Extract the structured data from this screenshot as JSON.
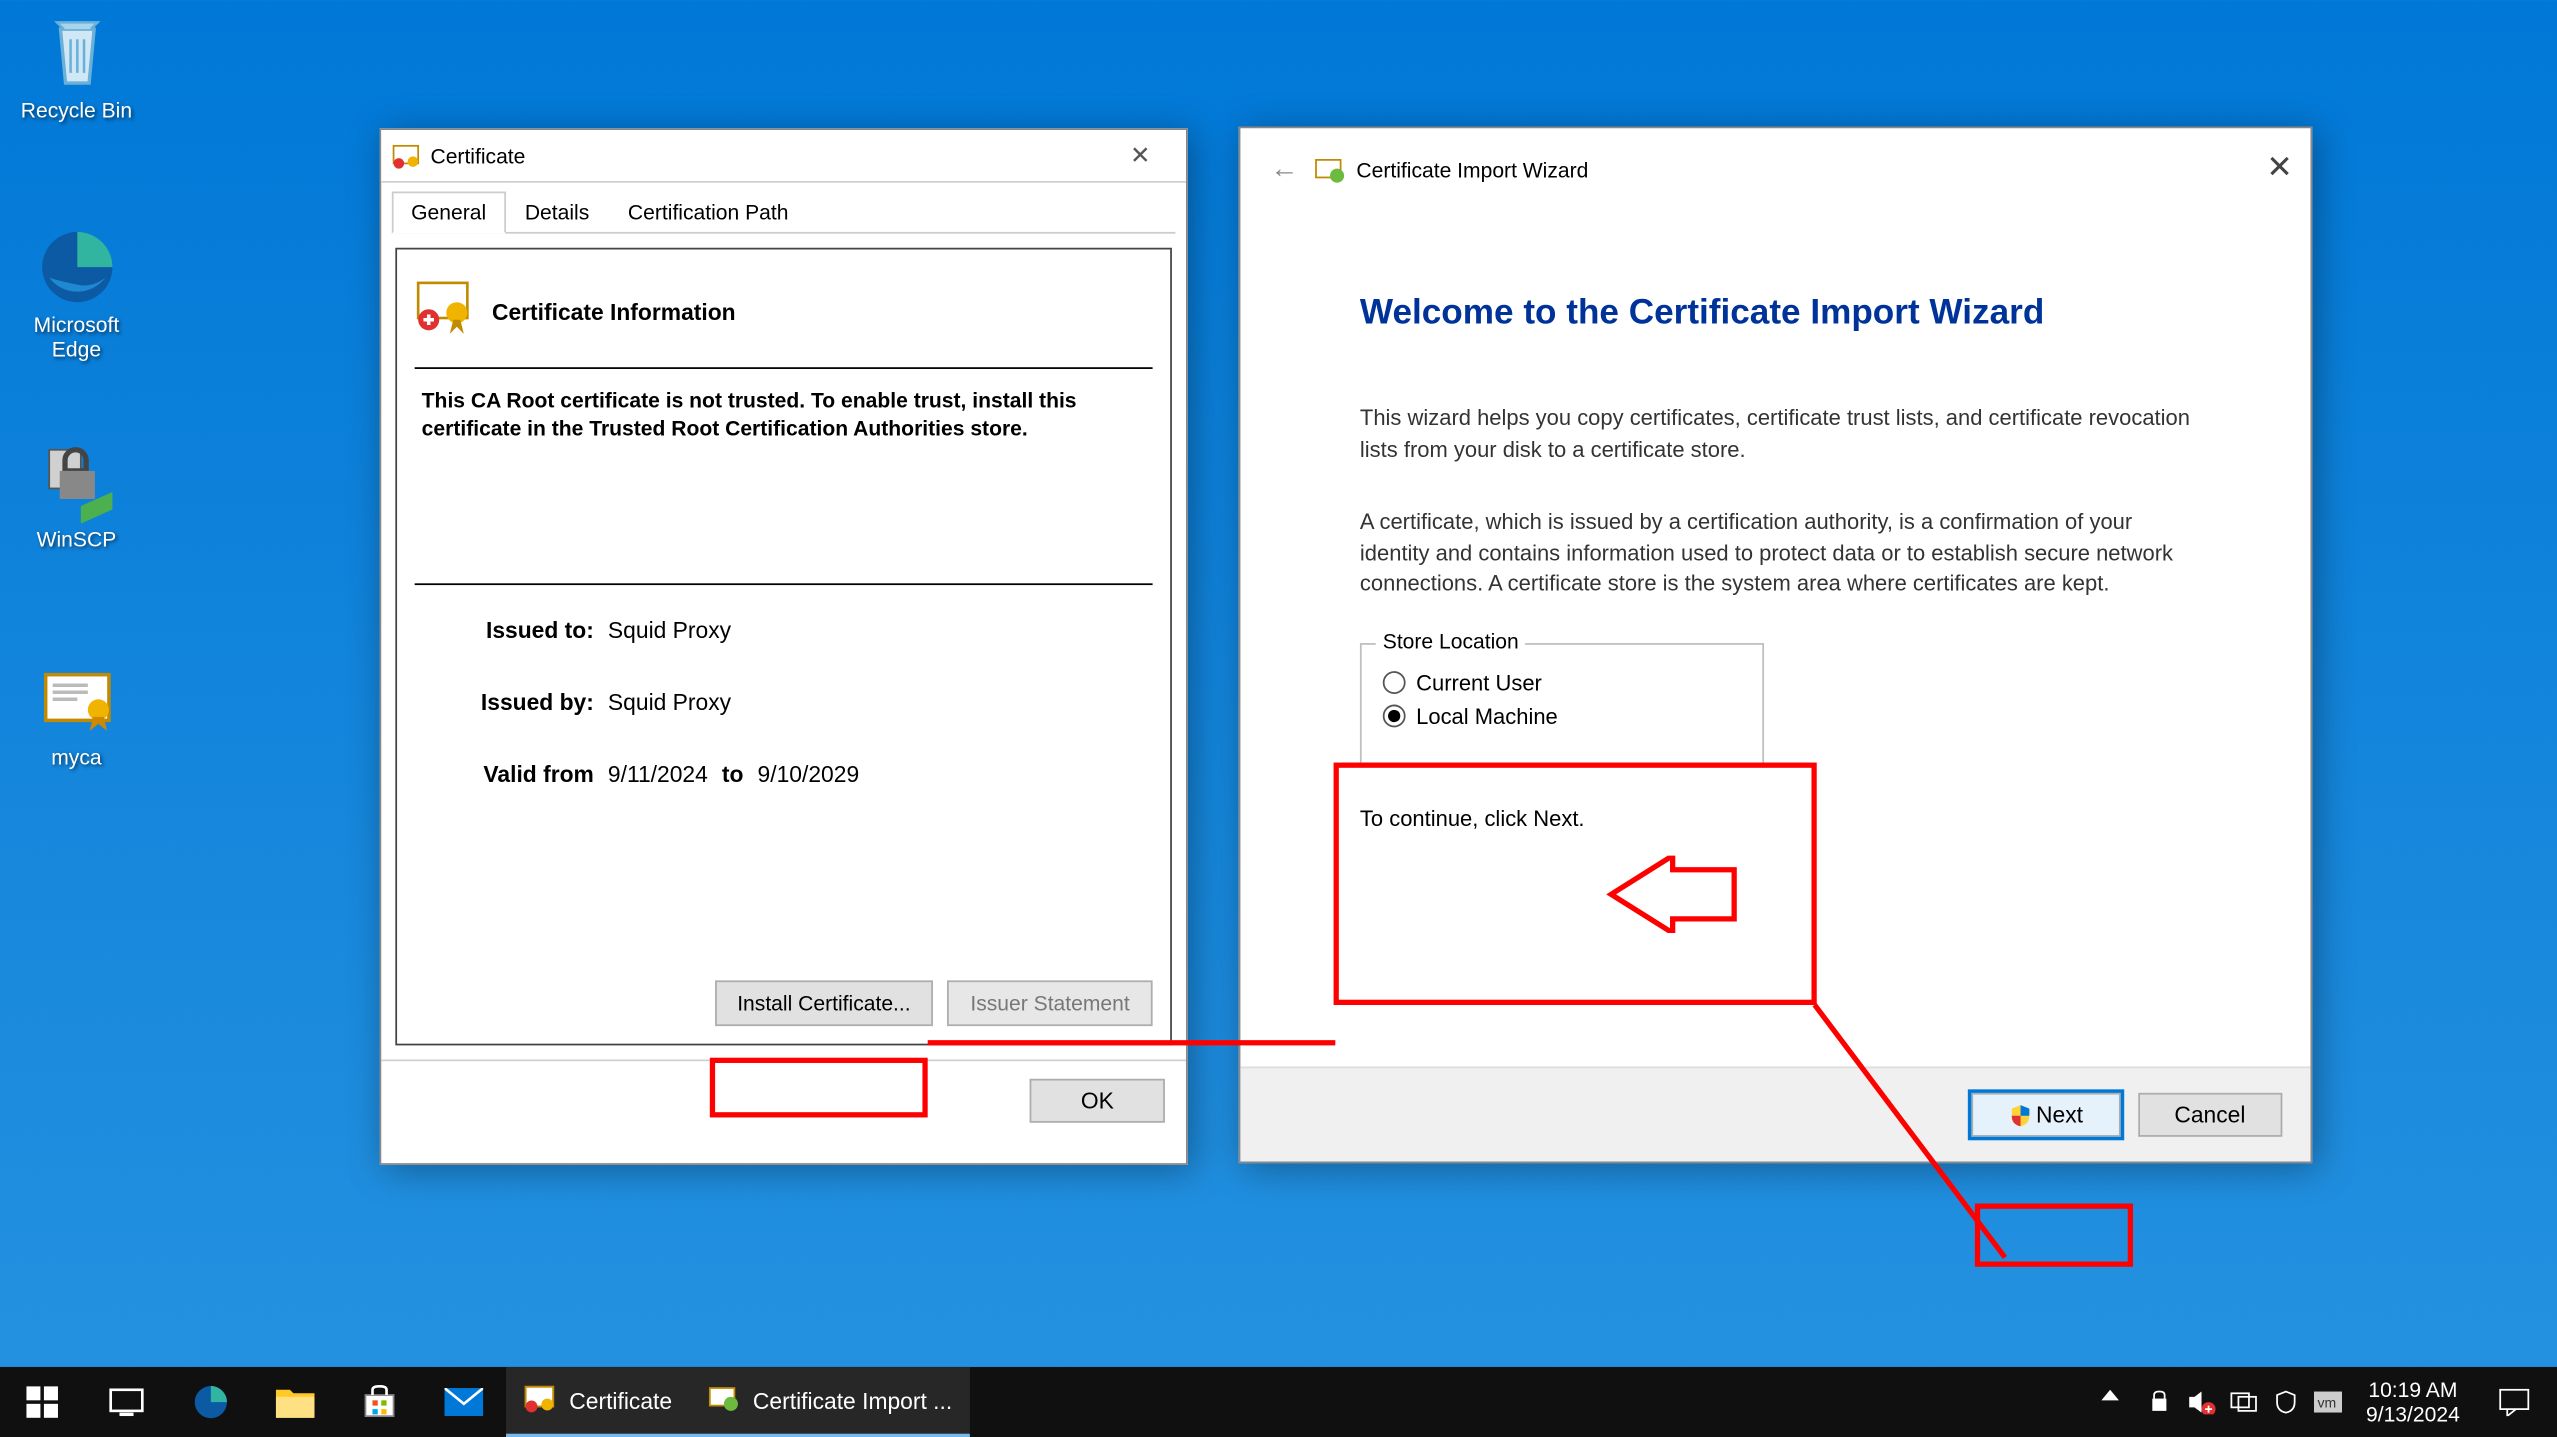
{
  "desktop": {
    "recycle": "Recycle Bin",
    "edge": "Microsoft Edge",
    "winscp": "WinSCP",
    "myca": "myca"
  },
  "cert": {
    "title": "Certificate",
    "tabs": {
      "general": "General",
      "details": "Details",
      "certpath": "Certification Path"
    },
    "header": "Certificate Information",
    "warn": "This CA Root certificate is not trusted. To enable trust, install this certificate in the Trusted Root Certification Authorities store.",
    "issued_to_k": "Issued to:",
    "issued_to_v": "Squid Proxy",
    "issued_by_k": "Issued by:",
    "issued_by_v": "Squid Proxy",
    "valid_k": "Valid from",
    "valid_from": "9/11/2024",
    "valid_to_lbl": "to",
    "valid_to": "9/10/2029",
    "install_btn": "Install Certificate...",
    "issuer_btn": "Issuer Statement",
    "ok": "OK"
  },
  "wizard": {
    "title": "Certificate Import Wizard",
    "welcome": "Welcome to the Certificate Import Wizard",
    "p1": "This wizard helps you copy certificates, certificate trust lists, and certificate revocation lists from your disk to a certificate store.",
    "p2": "A certificate, which is issued by a certification authority, is a confirmation of your identity and contains information used to protect data or to establish secure network connections. A certificate store is the system area where certificates are kept.",
    "store_legend": "Store Location",
    "opt_user": "Current User",
    "opt_machine": "Local Machine",
    "continue": "To continue, click Next.",
    "next": "Next",
    "cancel": "Cancel"
  },
  "taskbar": {
    "cert": "Certificate",
    "import": "Certificate Import ...",
    "time": "10:19 AM",
    "date": "9/13/2024"
  }
}
